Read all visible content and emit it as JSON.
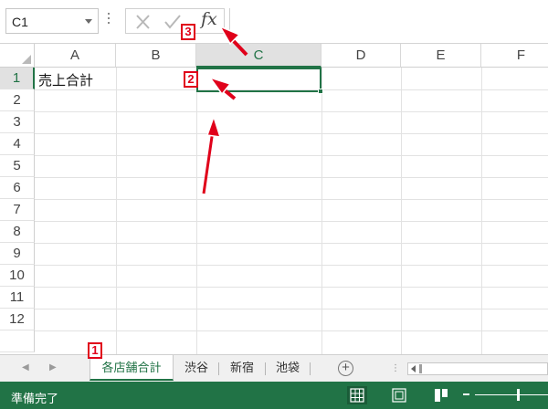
{
  "formula_bar": {
    "name_box_value": "C1",
    "fx_label": "fx",
    "formula_value": ""
  },
  "columns": [
    "A",
    "B",
    "C",
    "D",
    "E",
    "F"
  ],
  "rows": [
    "1",
    "2",
    "3",
    "4",
    "5",
    "6",
    "7",
    "8",
    "9",
    "10",
    "11",
    "12"
  ],
  "selected_cell": "C1",
  "cells": {
    "A1": "売上合計"
  },
  "sheet_tabs": [
    {
      "label": "各店舗合計",
      "active": true
    },
    {
      "label": "渋谷",
      "active": false
    },
    {
      "label": "新宿",
      "active": false
    },
    {
      "label": "池袋",
      "active": false
    }
  ],
  "add_sheet_symbol": "+",
  "tab_overflow": "⋮",
  "status": {
    "ready_text": "準備完了"
  },
  "annotations": {
    "badge_1": "1",
    "badge_2": "2",
    "badge_3": "3"
  },
  "colors": {
    "accent": "#217346",
    "annotation": "#e0001a"
  },
  "icons": {
    "cancel": "cross-icon",
    "enter": "check-icon",
    "name_box_dropdown": "chevron-down-icon",
    "add_sheet": "plus-circle-icon",
    "normal_view": "grid-view-icon",
    "page_layout_view": "page-layout-icon",
    "page_break_view": "page-break-icon"
  }
}
